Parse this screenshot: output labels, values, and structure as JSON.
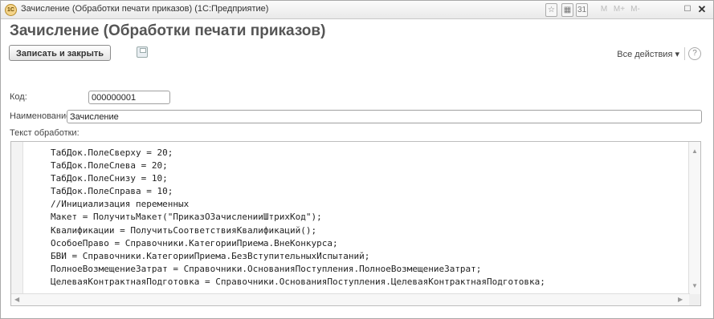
{
  "window": {
    "title": "Зачисление (Обработки печати приказов)  (1С:Предприятие)",
    "app_icon_text": "1С",
    "toolbar_buttons": [
      "M",
      "M+",
      "M-"
    ]
  },
  "form": {
    "title": "Зачисление (Обработки печати приказов)",
    "save_close_label": "Записать и закрыть",
    "all_actions_label": "Все действия ▾",
    "help_label": "?"
  },
  "fields": {
    "code_label": "Код:",
    "code_value": "000000001",
    "name_label": "Наименование:",
    "name_value": "Зачисление",
    "text_label": "Текст обработки:"
  },
  "code_lines": [
    "ТабДок.ПолеСверху = 20;",
    "ТабДок.ПолеСлева = 20;",
    "ТабДок.ПолеСнизу = 10;",
    "ТабДок.ПолеСправа = 10;",
    "//Инициализация переменных",
    "Макет = ПолучитьМакет(\"ПриказОЗачисленииШтрихКод\");",
    "Квалификации = ПолучитьСоответствияКвалификаций();",
    "ОсобоеПраво = Справочники.КатегорииПриема.ВнеКонкурса;",
    "БВИ = Справочники.КатегорииПриема.БезВступительныхИспытаний;",
    "ПолноеВозмещениеЗатрат = Справочники.ОснованияПоступления.ПолноеВозмещениеЗатрат;",
    "ЦелеваяКонтрактнаяПодготовка = Справочники.ОснованияПоступления.ЦелеваяКонтрактнаяПодготовка;"
  ]
}
